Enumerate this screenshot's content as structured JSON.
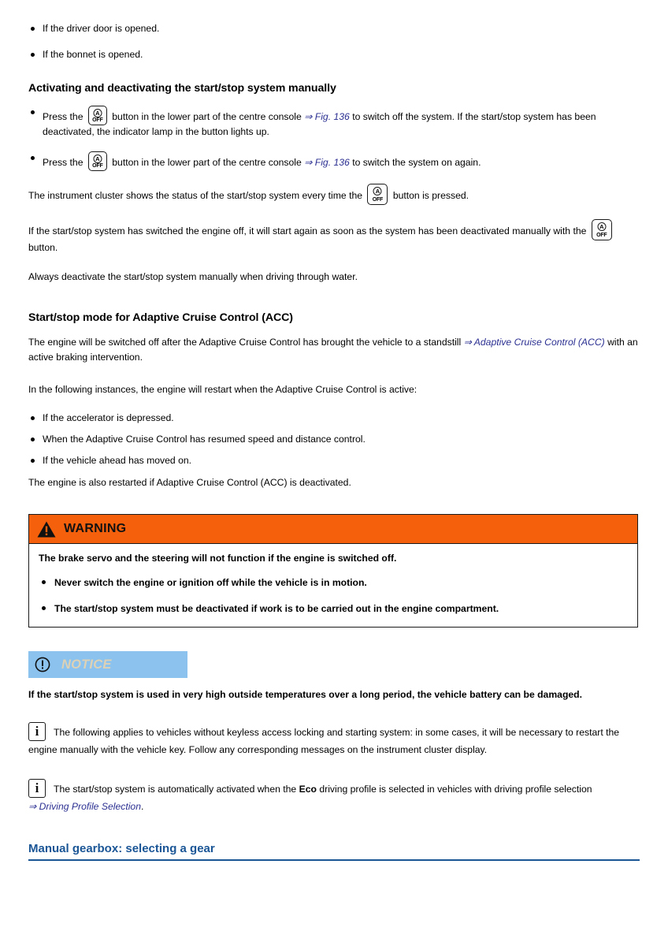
{
  "colors": {
    "warning_header_bg": "#f4600c",
    "notice_header_bg": "#8cc2ee",
    "notice_title_text": "#ddd2b6",
    "link_blue": "#2b2f91",
    "section_heading_blue": "#1a5596",
    "body_text": "#000000",
    "page_bg": "#ffffff"
  },
  "top_bullets": [
    {
      "text": "If the driver door is opened."
    },
    {
      "text": "If the bonnet is opened."
    }
  ],
  "section_manual": {
    "heading": "Activating and deactivating the start/stop system manually",
    "bullets": [
      {
        "pre": "Press the",
        "icon": "start-stop-off-button-icon",
        "mid": "button in the lower part of the centre console",
        "link": "⇒ Fig. 136",
        "post": "to switch off the system. If the start/stop system has been deactivated, the indicator lamp in the button lights up."
      },
      {
        "pre": "Press the",
        "icon": "start-stop-off-button-icon",
        "mid": "button in the lower part of the centre console",
        "link": "⇒ Fig. 136",
        "post": "to switch the system on again."
      }
    ],
    "cluster_para_pre": "The instrument cluster shows the status of the start/stop system every time the",
    "cluster_para_post": "button is pressed.",
    "restart_para_pre": "If the start/stop system has switched the engine off, it will start again as soon as the system has been deactivated manually with the",
    "restart_para_post": "button.",
    "water_para": "Always deactivate the start/stop system manually when driving through water."
  },
  "section_acc": {
    "heading": "Start/stop mode for Adaptive Cruise Control (ACC)",
    "intro_pre": "The engine will be switched off after the Adaptive Cruise Control has brought the vehicle to a standstill",
    "intro_link": "⇒ Adaptive Cruise Control (ACC)",
    "intro_post": "with an active braking intervention.",
    "instances_lead": "In the following instances, the engine will restart when the Adaptive Cruise Control is active:",
    "bullets": [
      {
        "text": "If the accelerator is depressed."
      },
      {
        "text": "When the Adaptive Cruise Control has resumed speed and distance control."
      },
      {
        "text": "If the vehicle ahead has moved on."
      }
    ],
    "closing": "The engine is also restarted if Adaptive Cruise Control (ACC) is deactivated."
  },
  "warning": {
    "title": "WARNING",
    "icon": "warning-triangle-icon",
    "lead": "The brake servo and the steering will not function if the engine is switched off.",
    "bullets": [
      {
        "text": "Never switch the engine or ignition off while the vehicle is in motion."
      },
      {
        "text": "The start/stop system must be deactivated if work is to be carried out in the engine compartment."
      }
    ]
  },
  "notice": {
    "title": "NOTICE",
    "icon": "exclamation-circle-icon",
    "body": "If the start/stop system is used in very high outside temperatures over a long period, the vehicle battery can be damaged."
  },
  "info_notes": [
    {
      "icon": "information-icon",
      "text": "The following applies to vehicles without keyless access locking and starting system: in some cases, it will be necessary to restart the engine manually with the vehicle key. Follow any corresponding messages on the instrument cluster display."
    },
    {
      "icon": "information-icon",
      "pre": "The start/stop system is automatically activated when the",
      "bold": "Eco",
      "mid": "driving profile is selected in vehicles with driving profile selection",
      "link": "⇒ Driving Profile Selection",
      "post": "."
    }
  ],
  "bottom_section": {
    "heading": "Manual gearbox: selecting a gear"
  },
  "button_icon": {
    "letter": "A",
    "label": "OFF"
  }
}
